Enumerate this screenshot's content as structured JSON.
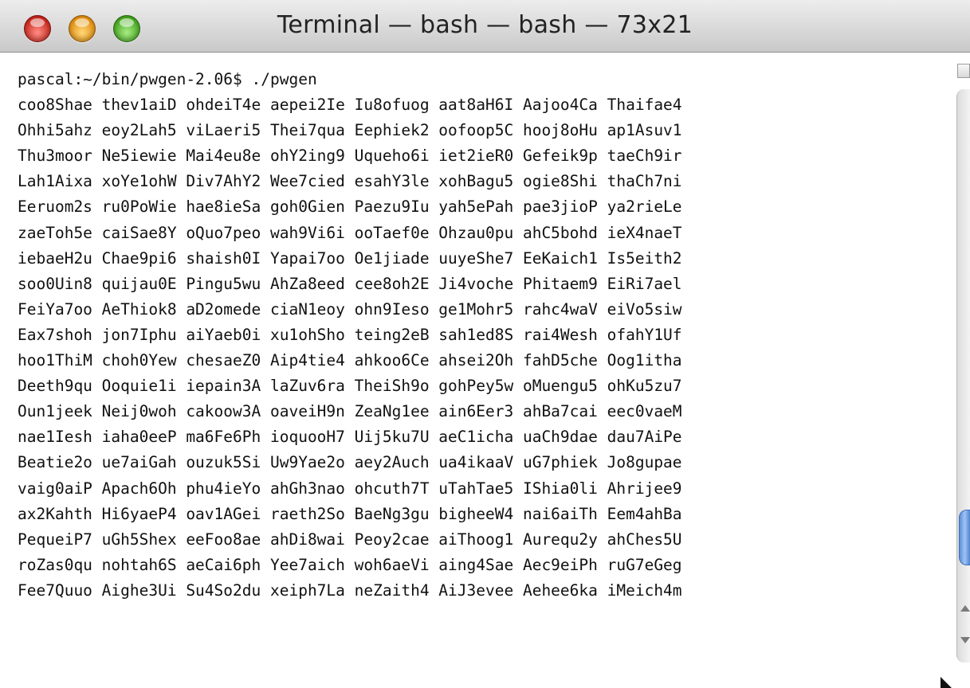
{
  "window": {
    "title": "Terminal — bash — bash — 73x21"
  },
  "terminal": {
    "prompt": "pascal:~/bin/pwgen-2.06$ ./pwgen",
    "rows": [
      "coo8Shae thev1aiD ohdeiT4e aepei2Ie Iu8ofuog aat8aH6I Aajoo4Ca Thaifae4",
      "Ohhi5ahz eoy2Lah5 viLaeri5 Thei7qua Eephiek2 oofoop5C hooj8oHu ap1Asuv1",
      "Thu3moor Ne5iewie Mai4eu8e ohY2ing9 Uqueho6i iet2ieR0 Gefeik9p taeCh9ir",
      "Lah1Aixa xoYe1ohW Div7AhY2 Wee7cied esahY3le xohBagu5 ogie8Shi thaCh7ni",
      "Eeruom2s ru0PoWie hae8ieSa goh0Gien Paezu9Iu yah5ePah pae3jioP ya2rieLe",
      "zaeToh5e caiSae8Y oQuo7peo wah9Vi6i ooTaef0e Ohzau0pu ahC5bohd ieX4naeT",
      "iebaeH2u Chae9pi6 shaish0I Yapai7oo Oe1jiade uuyeShe7 EeKaich1 Is5eith2",
      "soo0Uin8 quijau0E Pingu5wu AhZa8eed cee8oh2E Ji4voche Phitaem9 EiRi7ael",
      "FeiYa7oo AeThiok8 aD2omede ciaN1eoy ohn9Ieso ge1Mohr5 rahc4waV eiVo5siw",
      "Eax7shoh jon7Iphu aiYaeb0i xu1ohSho teing2eB sah1ed8S rai4Wesh ofahY1Uf",
      "hoo1ThiM choh0Yew chesaeZ0 Aip4tie4 ahkoo6Ce ahsei2Oh fahD5che Oog1itha",
      "Deeth9qu Ooquie1i iepain3A laZuv6ra TheiSh9o gohPey5w oMuengu5 ohKu5zu7",
      "Oun1jeek Neij0woh cakoow3A oaveiH9n ZeaNg1ee ain6Eer3 ahBa7cai eec0vaeM",
      "nae1Iesh iaha0eeP ma6Fe6Ph ioquooH7 Uij5ku7U aeC1icha uaCh9dae dau7AiPe",
      "Beatie2o ue7aiGah ouzuk5Si Uw9Yae2o aey2Auch ua4ikaaV uG7phiek Jo8gupae",
      "vaig0aiP Apach6Oh phu4ieYo ahGh3nao ohcuth7T uTahTae5 IShia0li Ahrijee9",
      "ax2Kahth Hi6yaeP4 oav1AGei raeth2So BaeNg3gu bigheeW4 nai6aiTh Eem4ahBa",
      "PequeiP7 uGh5Shex eeFoo8ae ahDi8wai Peoy2cae aiThoog1 Aurequ2y ahChes5U",
      "roZas0qu nohtah6S aeCai6ph Yee7aich woh6aeVi aing4Sae Aec9eiPh ruG7eGeg",
      "Fee7Quuo Aighe3Ui Su4So2du xeiph7La neZaith4 AiJ3evee Aehee6ka iMeich4m"
    ]
  },
  "colors": {
    "close": "#e0433a",
    "minimize": "#f2a531",
    "zoom": "#5fbf3a",
    "text": "#111111",
    "scroll_thumb": "#6f9de0"
  }
}
